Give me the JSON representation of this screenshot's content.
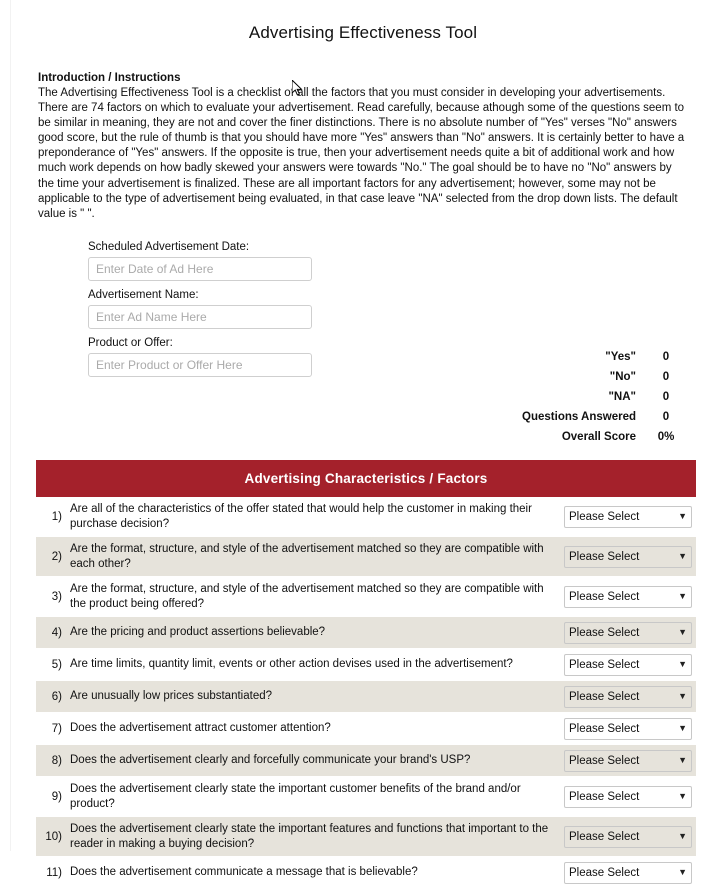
{
  "page": {
    "title": "Advertising Effectiveness Tool"
  },
  "intro": {
    "heading": "Introduction / Instructions",
    "body": "The Advertising Effectiveness Tool is a checklist of all the factors that you must consider in developing your advertisements.   There are 74 factors on which to evaluate your advertisement.  Read carefully, because athough some of the questions seem to be similar in meaning, they are not and cover the finer distinctions.  There is no absolute number of \"Yes\" verses \"No\" answers good score, but the rule of thumb is that you should have more \"Yes\" answers than \"No\" answers.   It is certainly better to have a preponderance of \"Yes\" answers.  If the opposite is true, then your advertisement needs quite a bit of additional work and how much work depends on how badly skewed your answers were towards \"No.\"    The goal should be to have no \"No\" answers by the time your advertisement is finalized.  These are all important factors for any advertisement; however, some may not be applicable to the type of advertisement being evaluated, in that case leave \"NA\" selected from the drop down lists.  The default value is \" \"."
  },
  "form": {
    "fields": [
      {
        "label": "Scheduled Advertisement Date:",
        "value": "",
        "placeholder": "Enter Date of Ad Here",
        "name": "scheduled-ad-date-input"
      },
      {
        "label": "Advertisement Name:",
        "value": "",
        "placeholder": "Enter Ad Name Here",
        "name": "advertisement-name-input"
      },
      {
        "label": "Product or Offer:",
        "value": "",
        "placeholder": "Enter Product or Offer Here",
        "name": "product-or-offer-input"
      }
    ]
  },
  "summary": {
    "rows": [
      {
        "label": "\"Yes\"",
        "value": "0"
      },
      {
        "label": "\"No\"",
        "value": "0"
      },
      {
        "label": "\"NA\"",
        "value": "0"
      },
      {
        "label": "Questions Answered",
        "value": "0"
      },
      {
        "label": "Overall Score",
        "value": "0%"
      }
    ]
  },
  "table": {
    "header": "Advertising Characteristics / Factors",
    "header_color": "#A4212B",
    "alt_row_color": "#E6E3DB",
    "select_default": "Please Select",
    "select_caret": "▼",
    "rows": [
      {
        "num": "1)",
        "question": "Are all of the characteristics of the offer stated that would help the customer in making their purchase decision?",
        "answer": "Please Select"
      },
      {
        "num": "2)",
        "question": "Are the format, structure, and style of the advertisement matched so they are compatible with each other?",
        "answer": "Please Select"
      },
      {
        "num": "3)",
        "question": "Are the format, structure, and style of the advertisement matched so they are compatible with the product being offered?",
        "answer": "Please Select"
      },
      {
        "num": "4)",
        "question": "Are the pricing and product assertions believable?",
        "answer": "Please Select"
      },
      {
        "num": "5)",
        "question": "Are time limits, quantity limit, events or other action devises used in the advertisement?",
        "answer": "Please Select"
      },
      {
        "num": "6)",
        "question": "Are unusually low prices substantiated?",
        "answer": "Please Select"
      },
      {
        "num": "7)",
        "question": "Does the advertisement attract customer attention?",
        "answer": "Please Select"
      },
      {
        "num": "8)",
        "question": "Does the advertisement clearly and forcefully communicate your brand's USP?",
        "answer": "Please Select"
      },
      {
        "num": "9)",
        "question": "Does the advertisement clearly state the important customer benefits of the brand and/or product?",
        "answer": "Please Select"
      },
      {
        "num": "10)",
        "question": "Does the advertisement clearly state the important features and functions that important to the reader in making a buying decision?",
        "answer": "Please Select"
      },
      {
        "num": "11)",
        "question": "Does the advertisement communicate a message that is believable?",
        "answer": "Please Select"
      }
    ]
  }
}
